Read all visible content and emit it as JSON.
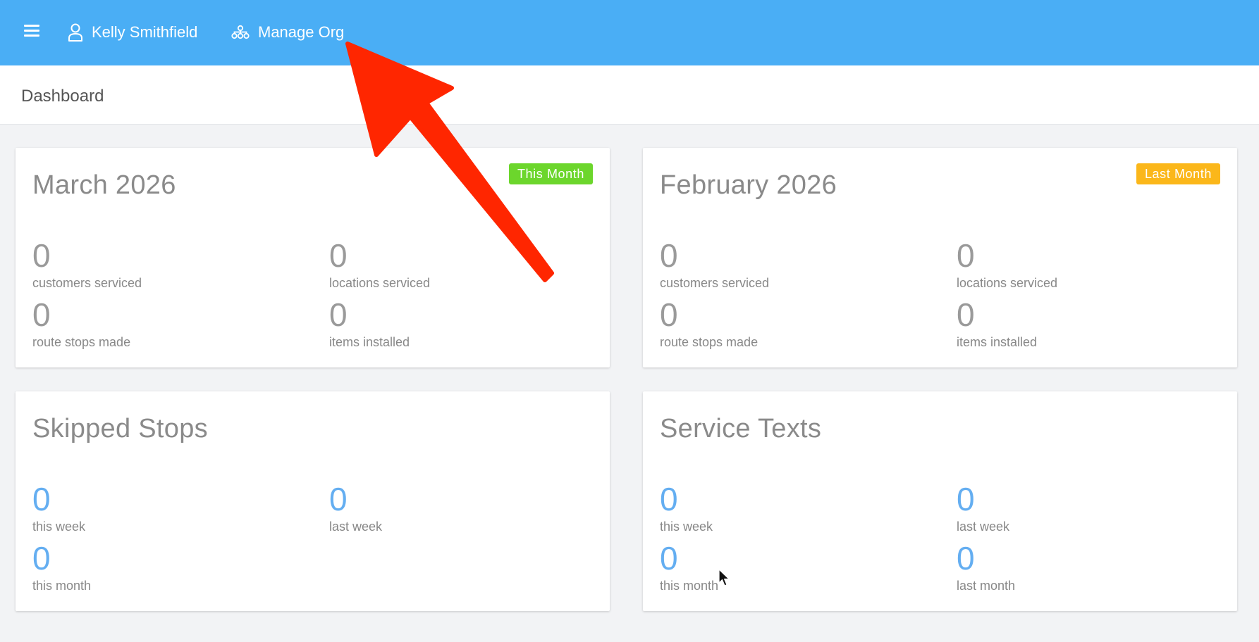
{
  "topbar": {
    "user_name": "Kelly Smithfield",
    "manage_org_label": "Manage Org",
    "background": "#4aaef5"
  },
  "subheader": {
    "title": "Dashboard"
  },
  "cards": {
    "this_month": {
      "title": "March 2026",
      "badge": "This Month",
      "badge_color": "#6cd62c",
      "stats": [
        {
          "value": "0",
          "label": "customers serviced"
        },
        {
          "value": "0",
          "label": "locations serviced"
        },
        {
          "value": "0",
          "label": "route stops made"
        },
        {
          "value": "0",
          "label": "items installed"
        }
      ]
    },
    "last_month": {
      "title": "February 2026",
      "badge": "Last Month",
      "badge_color": "#fbb71a",
      "stats": [
        {
          "value": "0",
          "label": "customers serviced"
        },
        {
          "value": "0",
          "label": "locations serviced"
        },
        {
          "value": "0",
          "label": "route stops made"
        },
        {
          "value": "0",
          "label": "items installed"
        }
      ]
    },
    "skipped_stops": {
      "title": "Skipped Stops",
      "stats": [
        {
          "value": "0",
          "label": "this week"
        },
        {
          "value": "0",
          "label": "last week"
        },
        {
          "value": "0",
          "label": "this month"
        }
      ]
    },
    "service_texts": {
      "title": "Service Texts",
      "stats": [
        {
          "value": "0",
          "label": "this week"
        },
        {
          "value": "0",
          "label": "last week"
        },
        {
          "value": "0",
          "label": "this month"
        },
        {
          "value": "0",
          "label": "last month"
        }
      ]
    }
  },
  "annotation": {
    "arrow_color": "#ff2600"
  }
}
